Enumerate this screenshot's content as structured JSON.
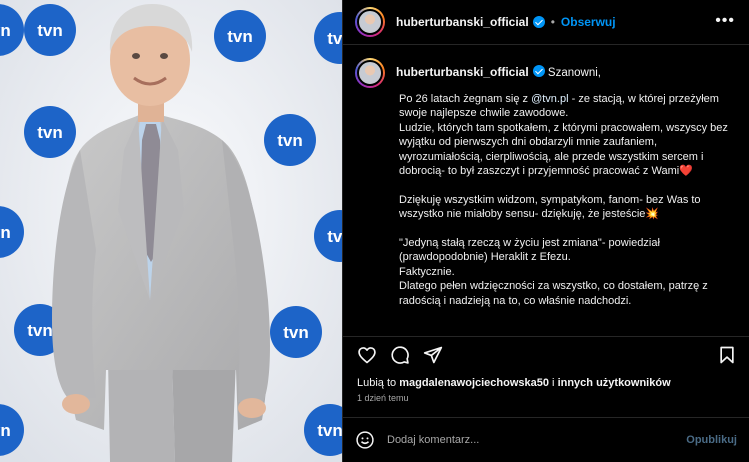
{
  "post": {
    "username": "huberturbanski_official",
    "follow_label": "Obserwuj",
    "separator": "•",
    "more_label": "•••"
  },
  "photo": {
    "logos": [
      "tvn",
      "tvn",
      "tvn",
      "tvn",
      "tvn",
      "tvn",
      "tvn",
      "tvn",
      "tvn",
      "tvn",
      "tvn",
      "tvn"
    ]
  },
  "caption": {
    "greeting": "Szanowni,",
    "body_before_mention": "Po 26 latach żegnam się z ",
    "mention": "@tvn.pl",
    "body_after_mention": " - ze stacją, w której przeżyłem swoje najlepsze chwile zawodowe.\nLudzie, których tam spotkałem, z którymi pracowałem, wszyscy bez wyjątku od pierwszych dni obdarzyli mnie zaufaniem, wyrozumiałością, cierpliwością, ale przede wszystkim sercem i dobrocią- to był zaszczyt i przyjemność pracować z Wami❤️\n\nDziękuję wszystkim widzom, sympatykom, fanom- bez Was to wszystko nie miałoby sensu- dziękuję, że jesteście💥\n\n\"Jedyną stałą rzeczą w życiu jest zmiana\"- powiedział (prawdopodobnie) Heraklit z Efezu.\nFaktycznie.\nDlatego pełen wdzięczności za wszystko, co dostałem, patrzę z radością i nadzieją na to, co właśnie nadchodzi."
  },
  "likes": {
    "prefix": "Lubią to ",
    "user": "magdalenawojciechowska50",
    "middle": " i ",
    "others": "innych użytkowników"
  },
  "time_ago": "1 dzień temu",
  "comment": {
    "placeholder": "Dodaj komentarz...",
    "publish_label": "Opublikuj"
  },
  "icons": {
    "like": "heart-icon",
    "comment": "comment-icon",
    "share": "send-icon",
    "save": "bookmark-icon",
    "emoji": "smiley-icon",
    "more": "more-icon",
    "verified": "verified-badge-icon"
  },
  "colors": {
    "accent": "#0095f6",
    "background": "#000000",
    "divider": "#262626",
    "logo_blue": "#1d64c8"
  }
}
